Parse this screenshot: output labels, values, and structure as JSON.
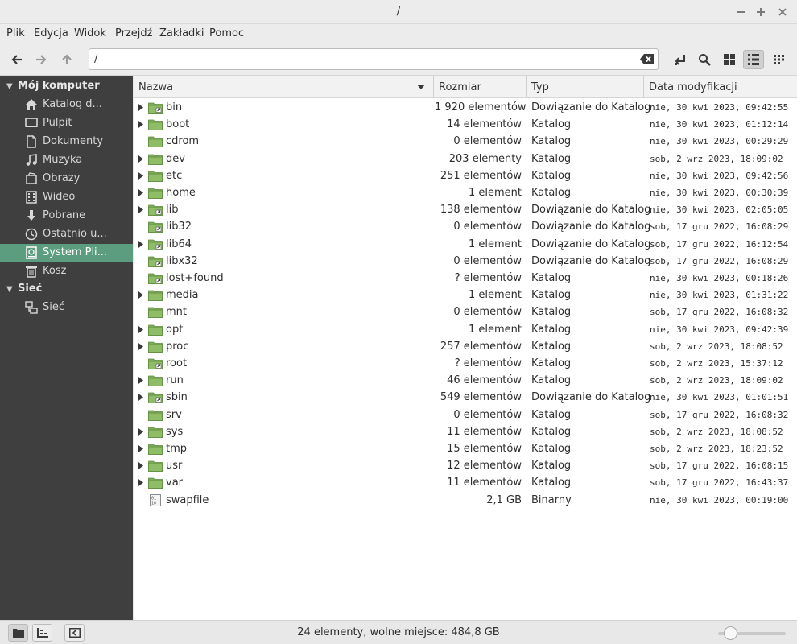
{
  "window": {
    "title": "/"
  },
  "menu": [
    "Plik",
    "Edycja",
    "Widok",
    "Przejdź",
    "Zakładki",
    "Pomoc"
  ],
  "toolbar": {
    "path_value": "/",
    "icons": [
      "back-arrow-icon",
      "forward-arrow-icon",
      "up-arrow-icon",
      "clear-entry-icon",
      "toggle-location-icon",
      "search-icon",
      "icon-view-icon",
      "list-view-icon",
      "compact-view-icon"
    ],
    "active_view": "list-view"
  },
  "sidebar": {
    "sections": [
      {
        "title": "Mój komputer",
        "items": [
          {
            "label": "Katalog d...",
            "icon": "home-icon"
          },
          {
            "label": "Pulpit",
            "icon": "desktop-icon"
          },
          {
            "label": "Dokumenty",
            "icon": "documents-icon"
          },
          {
            "label": "Muzyka",
            "icon": "music-icon"
          },
          {
            "label": "Obrazy",
            "icon": "pictures-icon"
          },
          {
            "label": "Wideo",
            "icon": "video-icon"
          },
          {
            "label": "Pobrane",
            "icon": "download-icon"
          },
          {
            "label": "Ostatnio u...",
            "icon": "recent-icon"
          },
          {
            "label": "System Pli...",
            "icon": "filesystem-icon",
            "active": true
          },
          {
            "label": "Kosz",
            "icon": "trash-icon"
          }
        ]
      },
      {
        "title": "Sieć",
        "items": [
          {
            "label": "Sieć",
            "icon": "network-icon"
          }
        ]
      }
    ],
    "active_color": "#5c9d7f"
  },
  "columns": {
    "name": "Nazwa",
    "size": "Rozmiar",
    "type": "Typ",
    "date": "Data modyfikacji"
  },
  "files": [
    {
      "name": "bin",
      "size": "1 920 elementów",
      "type": "Dowiązanie do Katalog",
      "date": "nie, 30 kwi 2023, 09:42:55",
      "expandable": true,
      "link": true
    },
    {
      "name": "boot",
      "size": "14 elementów",
      "type": "Katalog",
      "date": "nie, 30 kwi 2023, 01:12:14",
      "expandable": true,
      "link": false
    },
    {
      "name": "cdrom",
      "size": "0 elementów",
      "type": "Katalog",
      "date": "nie, 30 kwi 2023, 00:29:29",
      "expandable": false,
      "link": false
    },
    {
      "name": "dev",
      "size": "203 elementy",
      "type": "Katalog",
      "date": "sob, 2 wrz 2023, 18:09:02",
      "expandable": true,
      "link": false
    },
    {
      "name": "etc",
      "size": "251 elementów",
      "type": "Katalog",
      "date": "nie, 30 kwi 2023, 09:42:56",
      "expandable": true,
      "link": false
    },
    {
      "name": "home",
      "size": "1 element",
      "type": "Katalog",
      "date": "nie, 30 kwi 2023, 00:30:39",
      "expandable": true,
      "link": false
    },
    {
      "name": "lib",
      "size": "138 elementów",
      "type": "Dowiązanie do Katalog",
      "date": "nie, 30 kwi 2023, 02:05:05",
      "expandable": true,
      "link": true
    },
    {
      "name": "lib32",
      "size": "0 elementów",
      "type": "Dowiązanie do Katalog",
      "date": "sob, 17 gru 2022, 16:08:29",
      "expandable": false,
      "link": true
    },
    {
      "name": "lib64",
      "size": "1 element",
      "type": "Dowiązanie do Katalog",
      "date": "sob, 17 gru 2022, 16:12:54",
      "expandable": true,
      "link": true
    },
    {
      "name": "libx32",
      "size": "0 elementów",
      "type": "Dowiązanie do Katalog",
      "date": "sob, 17 gru 2022, 16:08:29",
      "expandable": false,
      "link": true
    },
    {
      "name": "lost+found",
      "size": "? elementów",
      "type": "Katalog",
      "date": "nie, 30 kwi 2023, 00:18:26",
      "expandable": false,
      "link": true
    },
    {
      "name": "media",
      "size": "1 element",
      "type": "Katalog",
      "date": "nie, 30 kwi 2023, 01:31:22",
      "expandable": true,
      "link": false
    },
    {
      "name": "mnt",
      "size": "0 elementów",
      "type": "Katalog",
      "date": "sob, 17 gru 2022, 16:08:32",
      "expandable": false,
      "link": false
    },
    {
      "name": "opt",
      "size": "1 element",
      "type": "Katalog",
      "date": "nie, 30 kwi 2023, 09:42:39",
      "expandable": true,
      "link": false
    },
    {
      "name": "proc",
      "size": "257 elementów",
      "type": "Katalog",
      "date": "sob, 2 wrz 2023, 18:08:52",
      "expandable": true,
      "link": false
    },
    {
      "name": "root",
      "size": "? elementów",
      "type": "Katalog",
      "date": "sob, 2 wrz 2023, 15:37:12",
      "expandable": false,
      "link": true
    },
    {
      "name": "run",
      "size": "46 elementów",
      "type": "Katalog",
      "date": "sob, 2 wrz 2023, 18:09:02",
      "expandable": true,
      "link": false
    },
    {
      "name": "sbin",
      "size": "549 elementów",
      "type": "Dowiązanie do Katalog",
      "date": "nie, 30 kwi 2023, 01:01:51",
      "expandable": true,
      "link": true
    },
    {
      "name": "srv",
      "size": "0 elementów",
      "type": "Katalog",
      "date": "sob, 17 gru 2022, 16:08:32",
      "expandable": false,
      "link": false
    },
    {
      "name": "sys",
      "size": "11 elementów",
      "type": "Katalog",
      "date": "sob, 2 wrz 2023, 18:08:52",
      "expandable": true,
      "link": false
    },
    {
      "name": "tmp",
      "size": "15 elementów",
      "type": "Katalog",
      "date": "sob, 2 wrz 2023, 18:23:52",
      "expandable": true,
      "link": false
    },
    {
      "name": "usr",
      "size": "12 elementów",
      "type": "Katalog",
      "date": "sob, 17 gru 2022, 16:08:15",
      "expandable": true,
      "link": false
    },
    {
      "name": "var",
      "size": "11 elementów",
      "type": "Katalog",
      "date": "sob, 17 gru 2022, 16:43:37",
      "expandable": true,
      "link": false
    },
    {
      "name": "swapfile",
      "size": "2,1 GB",
      "type": "Binarny",
      "date": "nie, 30 kwi 2023, 00:19:00",
      "expandable": false,
      "link": false,
      "binary": true
    }
  ],
  "status": {
    "text": "24 elementy, wolne miejsce: 484,8 GB",
    "zoom_level": 0.1
  },
  "colors": {
    "folder": "#7fae5a",
    "accent": "#5c9d7f"
  }
}
